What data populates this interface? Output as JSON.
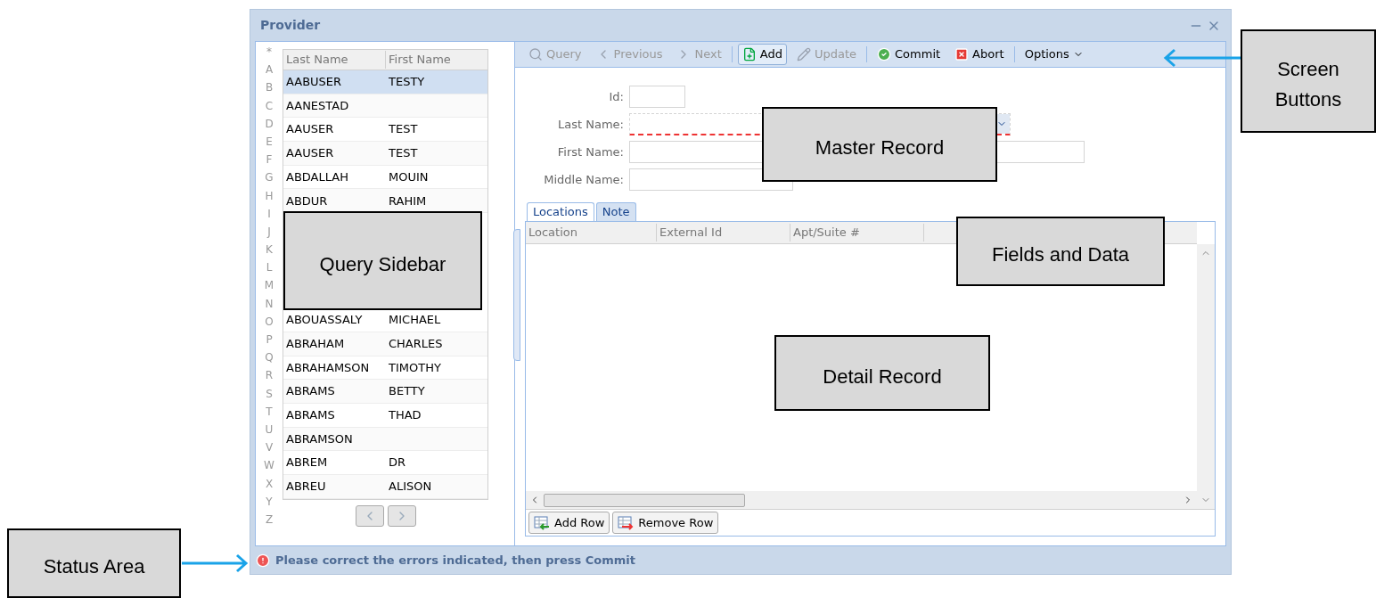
{
  "window": {
    "title": "Provider"
  },
  "sidebar": {
    "letters": [
      "*",
      "A",
      "B",
      "C",
      "D",
      "E",
      "F",
      "G",
      "H",
      "I",
      "J",
      "K",
      "L",
      "M",
      "N",
      "O",
      "P",
      "Q",
      "R",
      "S",
      "T",
      "U",
      "V",
      "W",
      "X",
      "Y",
      "Z"
    ],
    "columns": [
      "Last Name",
      "First Name"
    ],
    "rows_top": [
      {
        "last_name": "AABUSER",
        "first_name": "TESTY",
        "selected": true
      },
      {
        "last_name": "AANESTAD",
        "selected": false
      },
      {
        "last_name": "AAUSER",
        "first_name": "TEST",
        "selected": false
      },
      {
        "last_name": "AAUSER",
        "first_name": "TEST",
        "selected": false
      },
      {
        "last_name": "ABDALLAH",
        "first_name": "MOUIN",
        "selected": false
      },
      {
        "last_name": "ABDUR",
        "first_name": "RAHIM",
        "selected": false
      }
    ],
    "rows_bottom": [
      {
        "last_name": "ABOUASSALY",
        "first_name": "MICHAEL",
        "selected": false
      },
      {
        "last_name": "ABRAHAM",
        "first_name": "CHARLES",
        "selected": false
      },
      {
        "last_name": "ABRAHAMSON",
        "first_name": "TIMOTHY",
        "selected": false
      },
      {
        "last_name": "ABRAMS",
        "first_name": "BETTY",
        "selected": false
      },
      {
        "last_name": "ABRAMS",
        "first_name": "THAD",
        "selected": false
      },
      {
        "last_name": "ABRAMSON",
        "selected": false
      },
      {
        "last_name": "ABREM",
        "first_name": "DR",
        "selected": false
      },
      {
        "last_name": "ABREU",
        "first_name": "ALISON",
        "selected": false
      }
    ]
  },
  "toolbar": [
    {
      "kind": "query",
      "label": "Query",
      "disabled": true,
      "pressed": false,
      "separator_after": false
    },
    {
      "kind": "previous",
      "label": "Previous",
      "disabled": true,
      "pressed": false,
      "separator_after": false
    },
    {
      "kind": "next",
      "label": "Next",
      "disabled": true,
      "pressed": false,
      "separator_after": true
    },
    {
      "kind": "add",
      "label": "Add",
      "disabled": false,
      "pressed": true,
      "separator_after": false
    },
    {
      "kind": "update",
      "label": "Update",
      "disabled": true,
      "pressed": false,
      "separator_after": true
    },
    {
      "kind": "commit",
      "label": "Commit",
      "disabled": false,
      "pressed": false,
      "separator_after": false
    },
    {
      "kind": "abort",
      "label": "Abort",
      "disabled": false,
      "pressed": false,
      "separator_after": true
    },
    {
      "kind": "options",
      "label": "Options",
      "disabled": false,
      "pressed": false,
      "separator_after": false
    }
  ],
  "form": [
    {
      "label": "Id:",
      "kind": "short",
      "invalid": false
    },
    {
      "label": "Last Name:",
      "kind": "combo",
      "invalid": true
    },
    {
      "label": "First Name:",
      "kind": "long",
      "invalid": false
    },
    {
      "label": "Middle Name:",
      "kind": "medium",
      "invalid": false
    }
  ],
  "tabs": [
    {
      "label": "Locations",
      "selected": true
    },
    {
      "label": "Note",
      "selected": false
    }
  ],
  "grid": {
    "columns": [
      "Location",
      "External Id",
      "Apt/Suite #"
    ]
  },
  "grid_buttons": [
    {
      "kind": "add",
      "label": "Add Row"
    },
    {
      "kind": "remove",
      "label": "Remove Row"
    }
  ],
  "status_bar": {
    "message": "Please correct the errors indicated, then press Commit"
  },
  "callouts": [
    {
      "kind": "screen-buttons",
      "text": "Screen Buttons"
    },
    {
      "kind": "master",
      "text": "Master Record"
    },
    {
      "kind": "sidebar",
      "text": "Query Sidebar"
    },
    {
      "kind": "fields",
      "text": "Fields and Data"
    },
    {
      "kind": "detail",
      "text": "Detail Record"
    },
    {
      "kind": "status",
      "text": "Status Area"
    }
  ]
}
